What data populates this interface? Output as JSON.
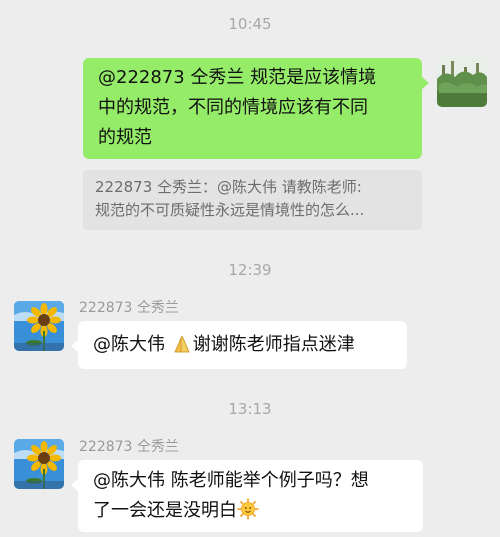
{
  "messages": {
    "time1": "10:45",
    "msg1": {
      "text_line1": "@222873 仝秀兰 规范是应该情境",
      "text_line2": "中的规范，不同的情境应该有不同",
      "text_line3": "的规范"
    },
    "quote1": {
      "line1": "222873 仝秀兰：@陈大伟 请教陈老师:",
      "line2": "规范的不可质疑性永远是情境性的怎么..."
    },
    "time2": "12:39",
    "msg2": {
      "sender": "222873 仝秀兰",
      "text_a": "@陈大伟 ",
      "text_b": "谢谢陈老师指点迷津",
      "emoji": "praying-hands-emoji"
    },
    "time3": "13:13",
    "msg3": {
      "sender": "222873 仝秀兰",
      "line1": "@陈大伟 陈老师能举个例子吗？想",
      "line2": "了一会还是没明白",
      "emoji": "sun-face-emoji"
    }
  },
  "colors": {
    "background": "#ededed",
    "my_bubble": "#95ec69",
    "other_bubble": "#ffffff",
    "quote_bg": "#e3e3e3"
  }
}
